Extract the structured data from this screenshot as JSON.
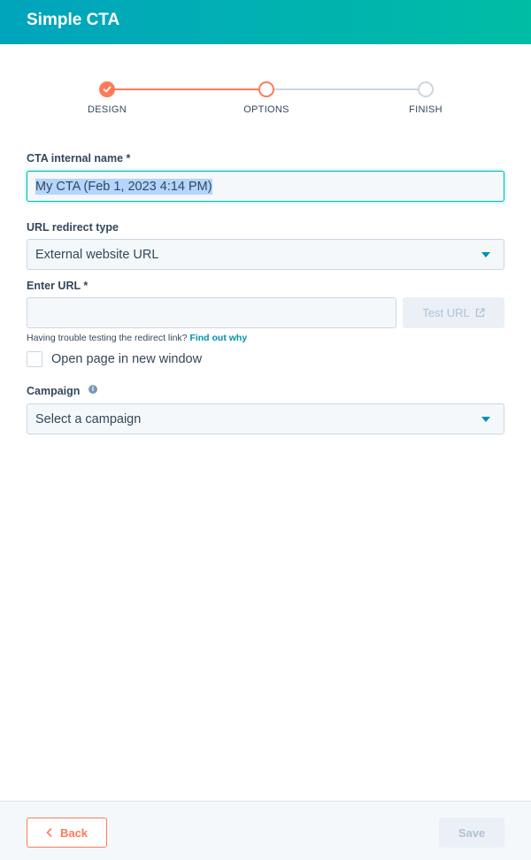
{
  "header": {
    "title": "Simple CTA"
  },
  "stepper": {
    "steps": [
      {
        "label": "DESIGN",
        "state": "done"
      },
      {
        "label": "OPTIONS",
        "state": "active"
      },
      {
        "label": "FINISH",
        "state": "todo"
      }
    ]
  },
  "cta_name": {
    "label": "CTA internal name *",
    "value": "My CTA (Feb 1, 2023 4:14 PM)"
  },
  "redirect_type": {
    "label": "URL redirect type",
    "selected": "External website URL"
  },
  "enter_url": {
    "label": "Enter URL *",
    "value": "",
    "test_button": "Test URL"
  },
  "help": {
    "text": "Having trouble testing the redirect link?",
    "link": "Find out why"
  },
  "new_window": {
    "label": "Open page in new window",
    "checked": false
  },
  "campaign": {
    "label": "Campaign",
    "placeholder": "Select a campaign"
  },
  "footer": {
    "back_label": "Back",
    "save_label": "Save"
  },
  "colors": {
    "accent": "#ff7a59",
    "teal": "#00bda5",
    "link": "#0091ae"
  }
}
